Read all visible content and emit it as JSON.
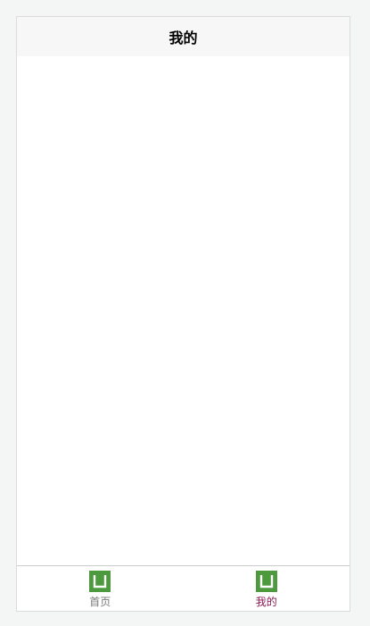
{
  "navbar": {
    "title": "我的"
  },
  "tabbar": {
    "items": [
      {
        "label": "首页",
        "icon": "app-tile-icon",
        "active": false
      },
      {
        "label": "我的",
        "icon": "app-tile-icon",
        "active": true
      }
    ]
  },
  "colors": {
    "active_tab": "#8b1a55",
    "inactive_tab": "#7a7a7a",
    "icon_green": "#4c9a3d",
    "navbar_bg": "#f7f7f7"
  }
}
